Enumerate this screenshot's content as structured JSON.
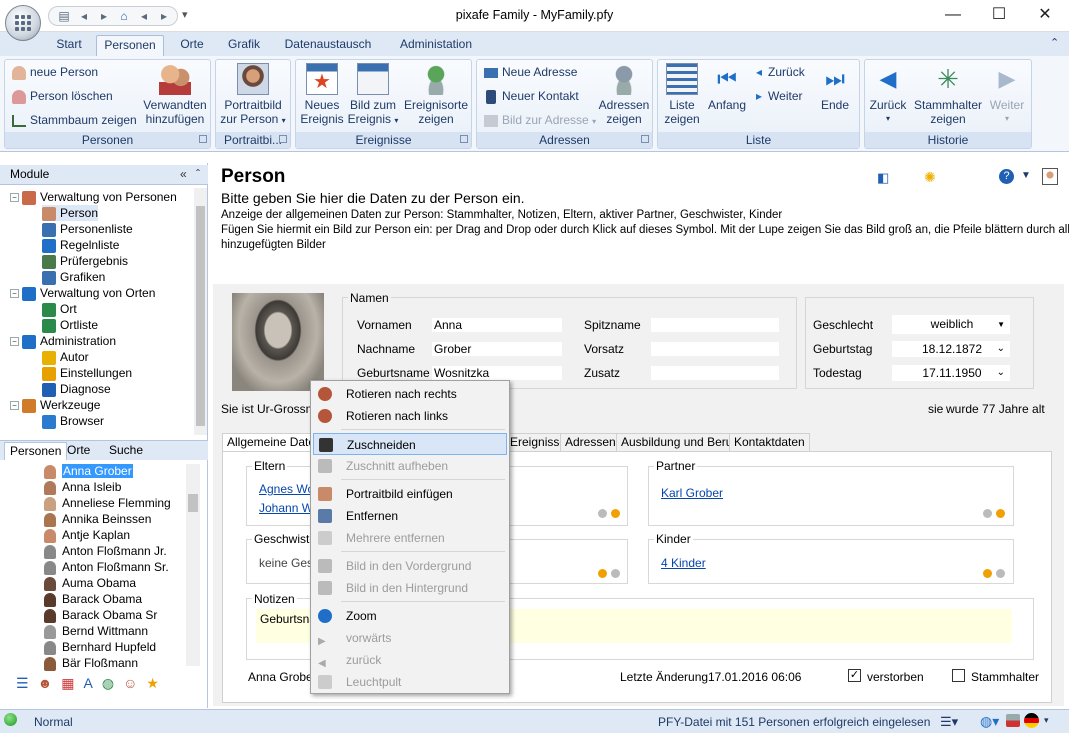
{
  "window": {
    "title": "pixafe Family - MyFamily.pfy",
    "minimize": "—",
    "maximize": "☐",
    "close": "✕"
  },
  "ribbon_tabs": [
    "Start",
    "Personen",
    "Orte",
    "Grafik",
    "Datenaustausch",
    "Administation"
  ],
  "ribbon": {
    "personen": {
      "label": "Personen",
      "neue_person": "neue Person",
      "person_loeschen": "Person löschen",
      "stammbaum": "Stammbaum zeigen",
      "verwandten_l1": "Verwandten",
      "verwandten_l2": "hinzufügen"
    },
    "portrait": {
      "label": "Portraitbi...",
      "b_l1": "Portraitbild",
      "b_l2": "zur Person"
    },
    "ereignisse": {
      "label": "Ereignisse",
      "neues_l1": "Neues",
      "neues_l2": "Ereignis",
      "bild_l1": "Bild zum",
      "bild_l2": "Ereignis",
      "orte_l1": "Ereignisorte",
      "orte_l2": "zeigen"
    },
    "adressen": {
      "label": "Adressen",
      "neue_adresse": "Neue Adresse",
      "neuer_kontakt": "Neuer Kontakt",
      "bild_adresse": "Bild zur Adresse",
      "zeigen_l1": "Adressen",
      "zeigen_l2": "zeigen"
    },
    "liste": {
      "label": "Liste",
      "liste_l1": "Liste",
      "liste_l2": "zeigen",
      "anfang": "Anfang",
      "zurueck": "Zurück",
      "weiter": "Weiter",
      "ende": "Ende"
    },
    "historie": {
      "label": "Historie",
      "zurueck": "Zurück",
      "stamm_l1": "Stammhalter",
      "stamm_l2": "zeigen",
      "weiter": "Weiter"
    }
  },
  "left": {
    "module_header": "Module",
    "tree": [
      {
        "label": "Verwaltung von Personen",
        "level": 0,
        "icon": "people-icon"
      },
      {
        "label": "Person",
        "level": 1,
        "icon": "person-icon",
        "selected": true
      },
      {
        "label": "Personenliste",
        "level": 1,
        "icon": "list-icon"
      },
      {
        "label": "Regelnliste",
        "level": 1,
        "icon": "rules-icon"
      },
      {
        "label": "Prüfergebnis",
        "level": 1,
        "icon": "check-icon"
      },
      {
        "label": "Grafiken",
        "level": 1,
        "icon": "graph-icon"
      },
      {
        "label": "Verwaltung von Orten",
        "level": 0,
        "icon": "house-icon"
      },
      {
        "label": "Ort",
        "level": 1,
        "icon": "globe-icon"
      },
      {
        "label": "Ortliste",
        "level": 1,
        "icon": "globe-list-icon"
      },
      {
        "label": "Administration",
        "level": 0,
        "icon": "gear-icon"
      },
      {
        "label": "Autor",
        "level": 1,
        "icon": "author-icon"
      },
      {
        "label": "Einstellungen",
        "level": 1,
        "icon": "settings-icon"
      },
      {
        "label": "Diagnose",
        "level": 1,
        "icon": "diagnose-icon"
      },
      {
        "label": "Werkzeuge",
        "level": 0,
        "icon": "tools-icon"
      },
      {
        "label": "Browser",
        "level": 1,
        "icon": "browser-icon"
      }
    ],
    "tabs": [
      "Personen",
      "Orte",
      "Suche"
    ],
    "persons": [
      "Anna Grober",
      "Anna Isleib",
      "Anneliese Flemming",
      "Annika Beinssen",
      "Antje Kaplan",
      "Anton Floßmann Jr.",
      "Anton Floßmann Sr.",
      "Auma Obama",
      "Barack Obama",
      "Barack Obama Sr",
      "Bernd Wittmann",
      "Bernhard Hupfeld",
      "Bär Floßmann"
    ]
  },
  "main": {
    "title": "Person",
    "subtitle": "Bitte geben Sie hier die Daten zu der Person ein.",
    "desc1": "Anzeige der allgemeinen Daten zur Person: Stammhalter, Notizen, Eltern, aktiver Partner, Geschwister, Kinder",
    "desc2": "Fügen Sie hiermit ein Bild zur Person ein: per Drag and Drop oder durch Klick auf dieses Symbol. Mit der Lupe zeigen Sie das Bild groß an, die Pfeile blättern durch alle",
    "desc3": "hinzugefügten Bilder",
    "names_legend": "Namen",
    "vorname_l": "Vornamen",
    "vorname": "Anna",
    "nachname_l": "Nachname",
    "nachname": "Grober",
    "geburtsname_l": "Geburtsname",
    "geburtsname": "Wosnitzka",
    "spitzname_l": "Spitzname",
    "vorsatz_l": "Vorsatz",
    "zusatz_l": "Zusatz",
    "geschlecht_l": "Geschlecht",
    "geschlecht": "weiblich",
    "geburtstag_l": "Geburtstag",
    "geburtstag": "18.12.1872",
    "todestag_l": "Todestag",
    "todestag": "17.11.1950",
    "ur_text": "Sie ist Ur-Grossmutt",
    "age_text_1": "sie",
    "age_text_2": "wurde 77 Jahre alt",
    "tabs": [
      "Allgemeine Daten",
      "Ereignisse",
      "Adressen",
      "Ausbildung und Beruf",
      "Kontaktdaten"
    ],
    "eltern_legend": "Eltern",
    "eltern": [
      "Agnes Wo",
      "Johann Wo"
    ],
    "partner_legend": "Partner",
    "partner": "Karl Grober",
    "geschwister_legend": "Geschwiste",
    "geschwister": "keine Gesc",
    "kinder_legend": "Kinder",
    "kinder": "4 Kinder",
    "notizen_legend": "Notizen",
    "notizen": "Geburtsna",
    "footer_name": "Anna Grober",
    "letzte_l": "Letzte Änderung",
    "letzte": "17.01.2016 06:06",
    "verstorben": "verstorben",
    "stammhalter": "Stammhalter"
  },
  "context_menu": [
    {
      "label": "Rotieren nach rechts",
      "enabled": true,
      "icon": "rotate-right-icon"
    },
    {
      "label": "Rotieren nach links",
      "enabled": true,
      "icon": "rotate-left-icon"
    },
    {
      "label": "Zuschneiden",
      "enabled": true,
      "icon": "crop-icon",
      "highlighted": true
    },
    {
      "label": "Zuschnitt aufheben",
      "enabled": false,
      "icon": "uncrop-icon"
    },
    {
      "label": "Portraitbild einfügen",
      "enabled": true,
      "icon": "portrait-insert-icon"
    },
    {
      "label": "Entfernen",
      "enabled": true,
      "icon": "remove-icon"
    },
    {
      "label": "Mehrere entfernen",
      "enabled": false,
      "icon": "remove-multiple-icon"
    },
    {
      "label": "Bild in den Vordergrund",
      "enabled": false,
      "icon": "bring-front-icon"
    },
    {
      "label": "Bild in den Hintergrund",
      "enabled": false,
      "icon": "send-back-icon"
    },
    {
      "label": "Zoom",
      "enabled": true,
      "icon": "zoom-icon"
    },
    {
      "label": "vorwärts",
      "enabled": false,
      "icon": "forward-icon"
    },
    {
      "label": "zurück",
      "enabled": false,
      "icon": "back-icon"
    },
    {
      "label": "Leuchtpult",
      "enabled": false,
      "icon": "lightbox-icon"
    }
  ],
  "status": {
    "mode": "Normal",
    "message": "PFY-Datei mit 151 Personen erfolgreich eingelesen"
  }
}
